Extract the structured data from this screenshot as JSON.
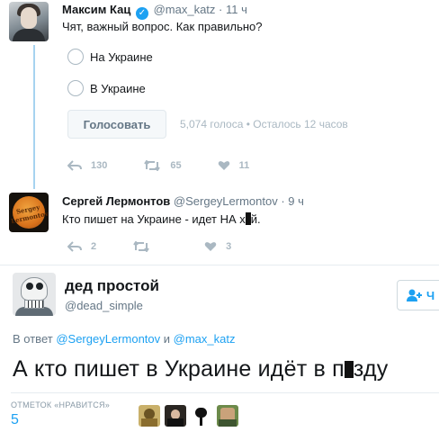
{
  "tweet1": {
    "name": "Максим Кац",
    "handle": "@max_katz",
    "time": "· 11 ч",
    "text": "Чят, важный вопрос. Как правильно?",
    "poll": {
      "options": [
        "На Украине",
        "В Украине"
      ],
      "vote_label": "Голосовать",
      "meta": "5,074 голоса • Осталось 12 часов"
    },
    "actions": {
      "replies": "130",
      "retweets": "65",
      "likes": "11"
    }
  },
  "tweet2": {
    "name": "Сергей Лермонтов",
    "handle": "@SergeyLermontov",
    "time": "· 9 ч",
    "text_before": "Кто пишет на Украине - идет НА х",
    "text_after": "й.",
    "avatar_label": "Sergey Lermontov",
    "actions": {
      "replies": "2",
      "retweets": "",
      "likes": "3"
    }
  },
  "main": {
    "name": "дед простой",
    "handle": "@dead_simple",
    "follow_partial": "Ч",
    "reply_prefix": "В ответ",
    "reply_mention1": "@SergeyLermontov",
    "reply_joiner": "и",
    "reply_mention2": "@max_katz",
    "text_before": "А кто пишет в Украине идёт в п",
    "text_after": "зду",
    "likes_label": "ОТМЕТОК «НРАВИТСЯ»",
    "likes_count": "5"
  },
  "colors": {
    "accent": "#1da1f2",
    "thread": "#a6d3f0",
    "muted": "#657786"
  }
}
